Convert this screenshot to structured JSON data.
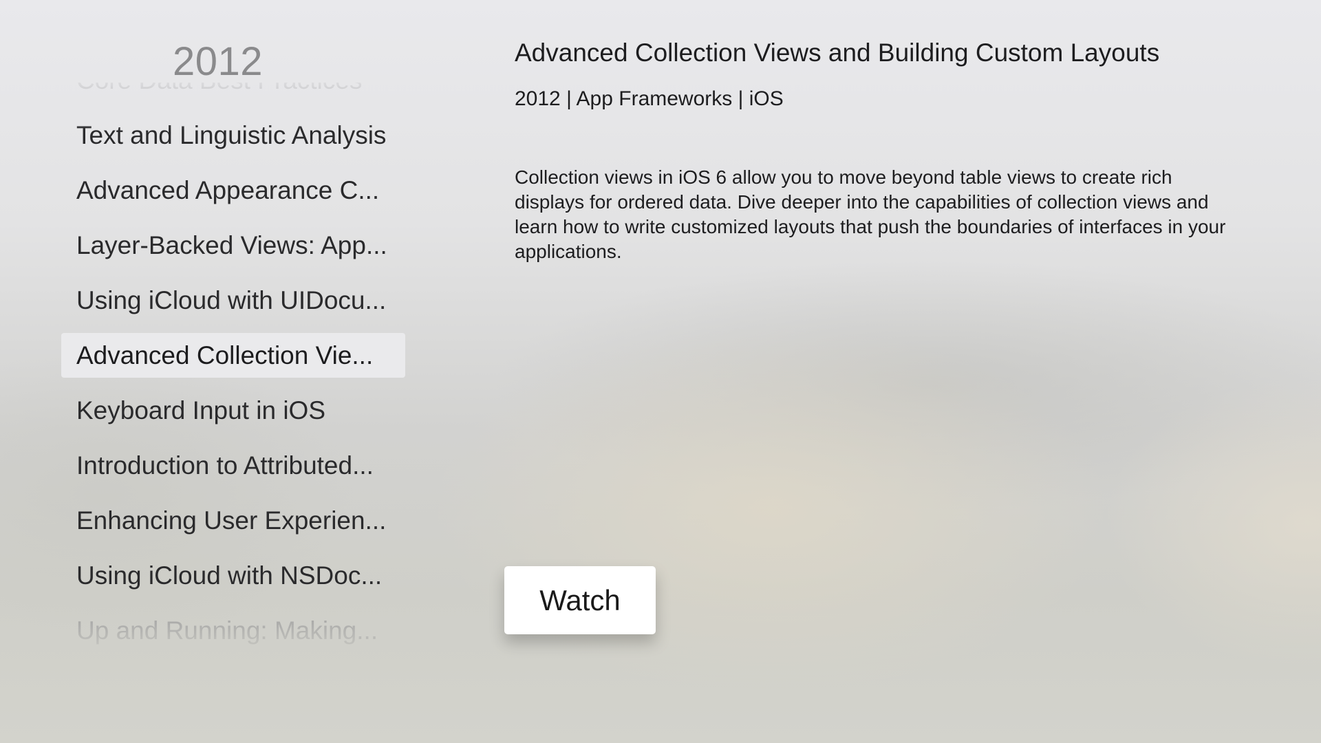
{
  "year_heading": "2012",
  "sessions": [
    {
      "label": "Core Data Best Practices"
    },
    {
      "label": "Text and Linguistic Analysis"
    },
    {
      "label": "Advanced Appearance C..."
    },
    {
      "label": "Layer-Backed Views: App..."
    },
    {
      "label": "Using iCloud with UIDocu..."
    },
    {
      "label": "Advanced Collection Vie..."
    },
    {
      "label": "Keyboard Input in iOS"
    },
    {
      "label": "Introduction to Attributed..."
    },
    {
      "label": "Enhancing User Experien..."
    },
    {
      "label": "Using iCloud with NSDoc..."
    },
    {
      "label": "Up and Running: Making..."
    }
  ],
  "selected_index": 5,
  "detail": {
    "title": "Advanced Collection Views and Building Custom Layouts",
    "meta": "2012 | App Frameworks | iOS",
    "description": "Collection views in iOS 6 allow you to move beyond table views to create rich displays for ordered data. Dive deeper into the capabilities of collection views and learn how to write customized layouts that push the boundaries of interfaces in your applications.",
    "watch_label": "Watch"
  }
}
